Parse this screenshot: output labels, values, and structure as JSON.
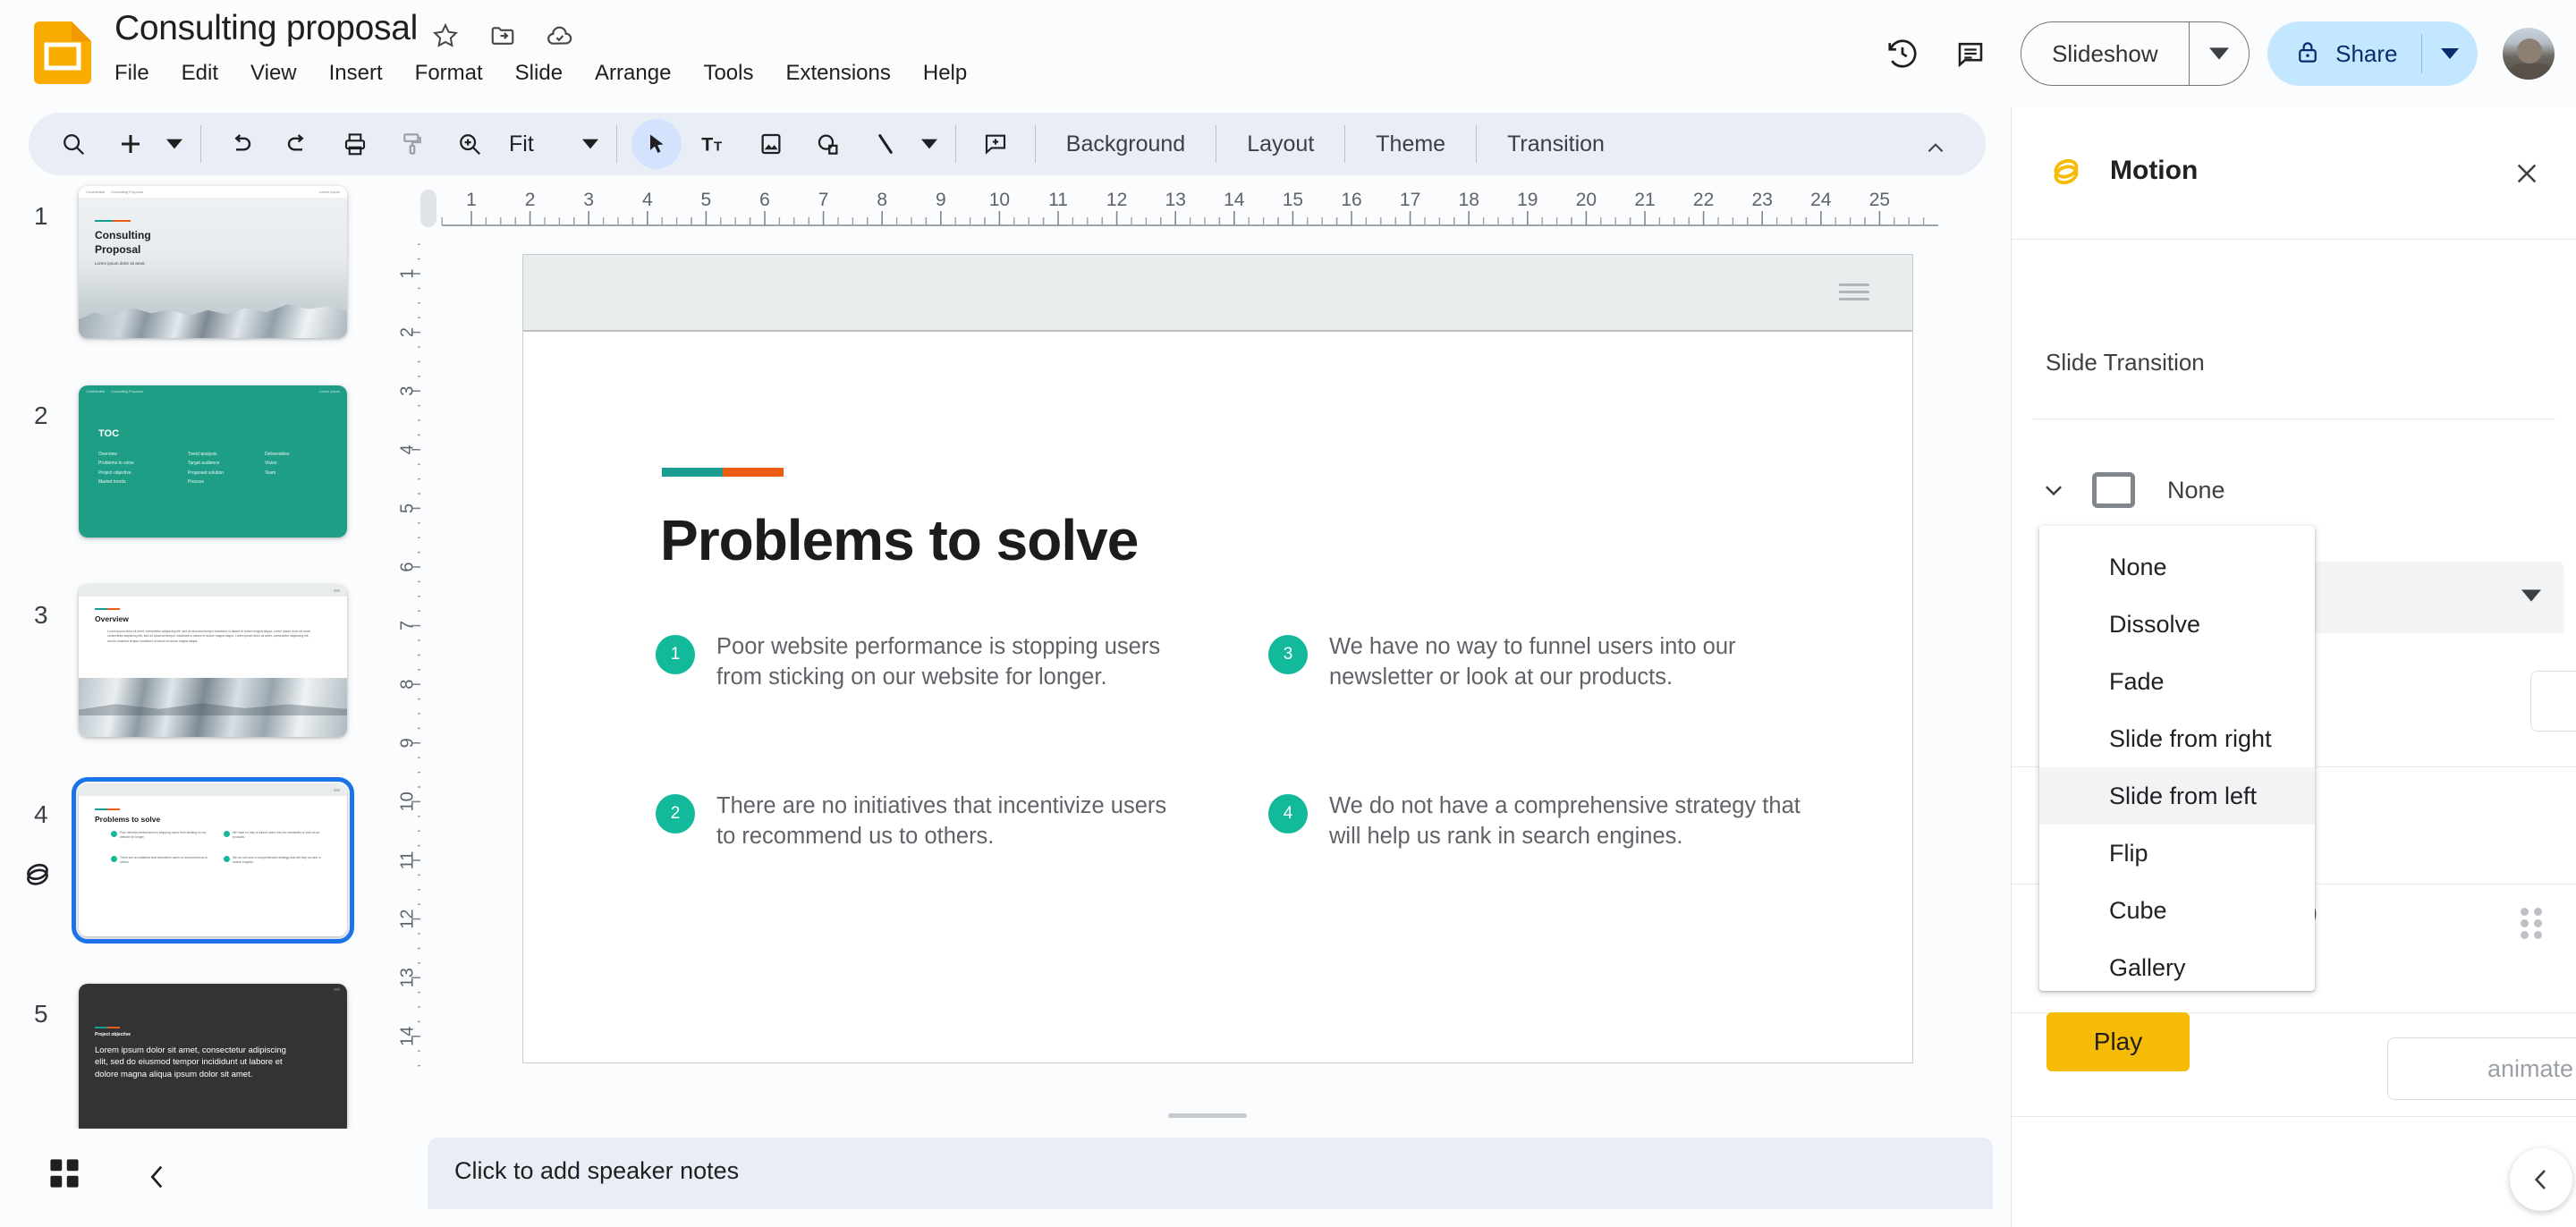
{
  "app": {
    "name": "Google Slides",
    "doc_title": "Consulting proposal",
    "colors": {
      "brand_yellow": "#f6bb06",
      "accent_teal": "#189c8f",
      "accent_orange": "#ec5b16",
      "bullet_green": "#12b99a",
      "share_blue": "#c2e7ff",
      "selection_blue": "#1a73e8",
      "toolbar_bg": "#e9eef6"
    }
  },
  "header": {
    "title_icons": [
      "star-icon",
      "move-to-folder-icon",
      "cloud-saved-icon"
    ],
    "menus": [
      "File",
      "Edit",
      "View",
      "Insert",
      "Format",
      "Slide",
      "Arrange",
      "Tools",
      "Extensions",
      "Help"
    ],
    "right_icons": [
      "version-history-icon",
      "comment-icon"
    ],
    "slideshow_label": "Slideshow",
    "share_label": "Share",
    "share_lock_icon": "lock-icon"
  },
  "toolbar": {
    "items": [
      {
        "name": "search-icon",
        "type": "icon"
      },
      {
        "name": "add-icon",
        "type": "icon"
      },
      {
        "name": "add-caret",
        "type": "caret"
      },
      {
        "name": "divider",
        "type": "divider"
      },
      {
        "name": "undo-icon",
        "type": "icon"
      },
      {
        "name": "redo-icon",
        "type": "icon"
      },
      {
        "name": "print-icon",
        "type": "icon"
      },
      {
        "name": "paint-format-icon",
        "type": "icon"
      },
      {
        "name": "zoom-icon",
        "type": "icon"
      }
    ],
    "zoom_label": "Fit",
    "zoom_caret": "chevron-down-icon",
    "tools": [
      "select-cursor-icon",
      "text-box-icon",
      "insert-image-icon",
      "shape-icon",
      "line-icon"
    ],
    "line_caret": "chevron-down-icon",
    "comment_icon": "add-comment-icon",
    "text_buttons": [
      "Background",
      "Layout",
      "Theme",
      "Transition"
    ],
    "collapse_icon": "chevron-up-icon"
  },
  "rulers": {
    "horizontal_ticks": [
      "1",
      "2",
      "3",
      "4",
      "5",
      "6",
      "7",
      "8",
      "9",
      "10",
      "11",
      "12",
      "13",
      "14",
      "15",
      "16",
      "17",
      "18",
      "19",
      "20",
      "21",
      "22",
      "23",
      "24",
      "25"
    ],
    "vertical_ticks": [
      "1",
      "2",
      "3",
      "4",
      "5",
      "6",
      "7",
      "8",
      "9",
      "10",
      "11",
      "12",
      "13",
      "14"
    ]
  },
  "filmstrip": {
    "slides": [
      {
        "number": "1",
        "selected": false,
        "has_animation": false,
        "kind": "title",
        "title_line1": "Consulting",
        "title_line2": "Proposal",
        "subtitle": "Lorem ipsum dolor sit amet.",
        "head_left": "Confidential",
        "head_mid": "Consulting Proposal",
        "head_right": "Lorem ipsum"
      },
      {
        "number": "2",
        "selected": false,
        "has_animation": false,
        "kind": "toc",
        "title": "TOC",
        "items_col1": [
          "Overview",
          "Problems to solve",
          "Project objective",
          "Market trends"
        ],
        "items_col2": [
          "Trend analysis",
          "Target audience",
          "Proposed solution",
          "Process"
        ],
        "items_col3": [
          "Deliverables",
          "Vision",
          "Team"
        ]
      },
      {
        "number": "3",
        "selected": false,
        "has_animation": false,
        "kind": "overview",
        "title": "Overview",
        "body": "Lorem ipsum dolor sit amet, consectetur adipiscing elit, sed do eiusmod tempor incididunt ut labore et dolore magna aliqua. Lorem ipsum dolor sit amet, consectetur adipiscing elit, sed do eiusmod tempor incididunt ut labore et dolore magna aliqua. Lorem ipsum dolor sit amet, consectetur adipiscing elit, sed do eiusmod tempor incididunt ut labore et dolore magna aliqua."
      },
      {
        "number": "4",
        "selected": true,
        "has_animation": true,
        "kind": "problems",
        "title": "Problems to solve",
        "bullets": [
          "Poor website performance is stopping users from sticking on our website for longer.",
          "There are no initiatives that incentivize users to recommend us to others.",
          "We have no way to funnel users into our newsletter or look at our products.",
          "We do not have a comprehensive strategy that will help us rank in search engines."
        ]
      },
      {
        "number": "5",
        "selected": false,
        "has_animation": false,
        "kind": "objective",
        "eyebrow": "Project objective",
        "body": "Lorem ipsum dolor sit amet, consectetur adipiscing elit, sed do eiusmod tempor incididunt ut labore et dolore magna aliqua ipsum dolor sit amet."
      }
    ]
  },
  "slide": {
    "title": "Problems to solve",
    "bullets": [
      {
        "number": "1",
        "text": "Poor website performance is stopping users from sticking on our website for longer."
      },
      {
        "number": "3",
        "text": "We have no way to funnel users into our newsletter or look at our products."
      },
      {
        "number": "2",
        "text": "There are no initiatives that incentivize users to recommend us to others."
      },
      {
        "number": "4",
        "text": "We do not have a comprehensive strategy that will help us rank in search engines."
      }
    ]
  },
  "notes": {
    "placeholder": "Click to add speaker notes",
    "grid_icon": "grid-view-icon",
    "prev_icon": "chevron-left-icon"
  },
  "motion_panel": {
    "logo_icon": "motion-logo-icon",
    "title": "Motion",
    "close_icon": "close-icon",
    "section_label": "Slide Transition",
    "expand_icon": "chevron-down-icon",
    "transition_preview_icon": "slide-icon",
    "transition_name": "None",
    "select_value": "None",
    "select_caret": "chevron-down-icon",
    "animate_row_text": "ick)",
    "drag_handle_icon": "drag-handle-icon",
    "add_animation_label": "animate",
    "play_label": "Play",
    "collapse_icon": "chevron-left-icon"
  },
  "dropdown": {
    "highlighted": "Slide from left",
    "options": [
      "None",
      "Dissolve",
      "Fade",
      "Slide from right",
      "Slide from left",
      "Flip",
      "Cube",
      "Gallery"
    ]
  }
}
